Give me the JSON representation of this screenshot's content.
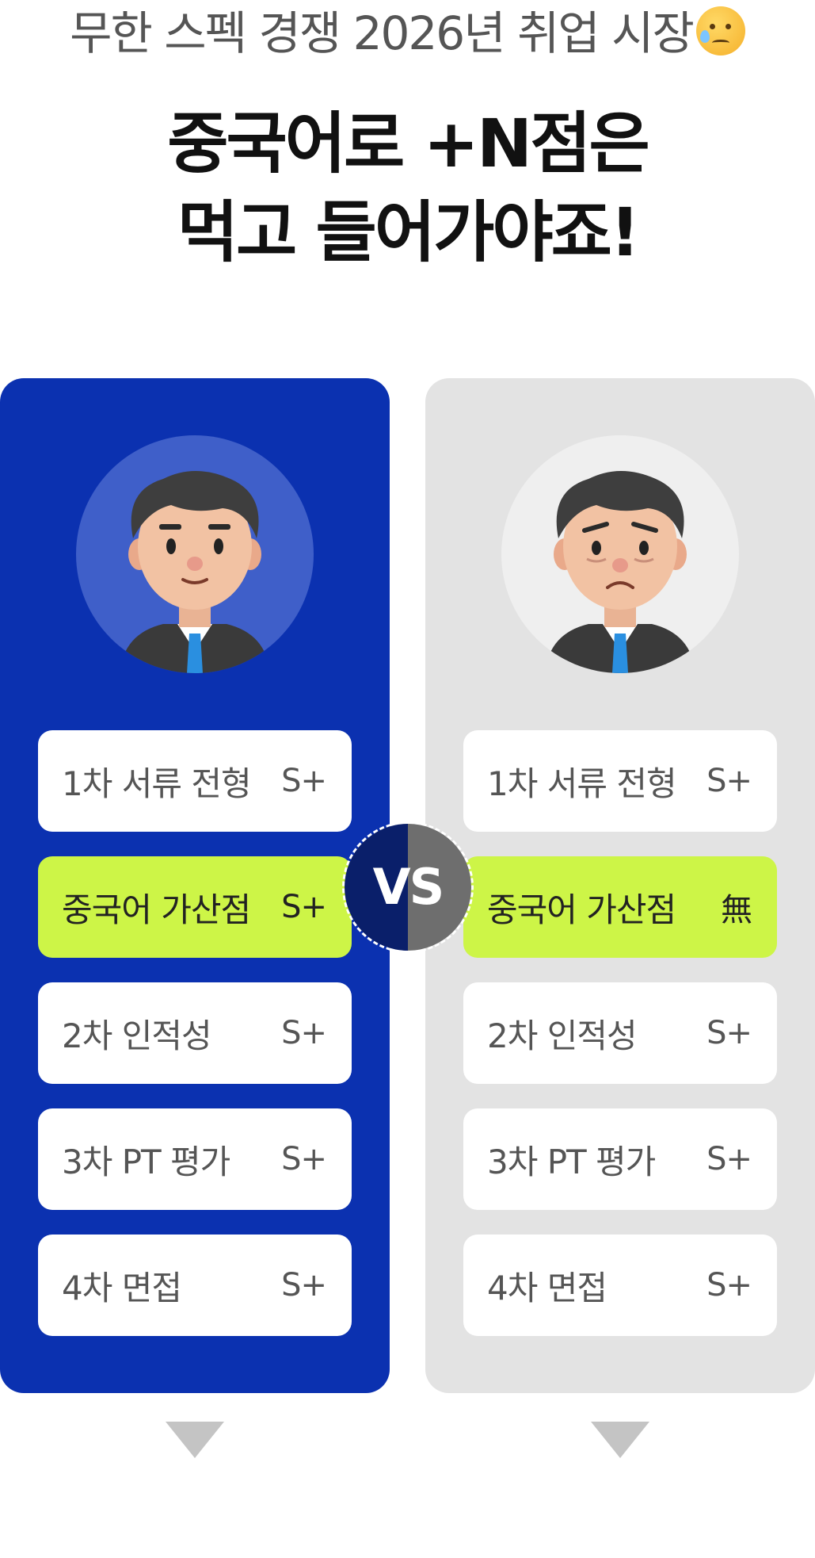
{
  "header": {
    "subtitle": "무한 스펙 경쟁 2026년 취업 시장",
    "subtitle_emoji": "crying-face-emoji",
    "headline_line1": "중국어로 +N점은",
    "headline_line2": "먹고 들어가야죠!"
  },
  "colors": {
    "left_panel": "#0b31b0",
    "right_panel": "#e3e3e3",
    "highlight": "#cdf547",
    "vs_left": "#0a1f6a",
    "vs_right": "#6e6e6e"
  },
  "left": {
    "avatar": "smiling-man-avatar",
    "rows": [
      {
        "label": "1차 서류 전형",
        "value": "S+"
      },
      {
        "label": "중국어 가산점",
        "value": "S+"
      },
      {
        "label": "2차 인적성",
        "value": "S+"
      },
      {
        "label": "3차 PT 평가",
        "value": "S+"
      },
      {
        "label": "4차 면접",
        "value": "S+"
      }
    ]
  },
  "right": {
    "avatar": "worried-man-avatar",
    "rows": [
      {
        "label": "1차 서류 전형",
        "value": "S+"
      },
      {
        "label": "중국어 가산점",
        "value": "無"
      },
      {
        "label": "2차 인적성",
        "value": "S+"
      },
      {
        "label": "3차 PT 평가",
        "value": "S+"
      },
      {
        "label": "4차 면접",
        "value": "S+"
      }
    ]
  },
  "vs_label": "VS",
  "icons": {
    "arrow": "triangle-down-icon"
  }
}
